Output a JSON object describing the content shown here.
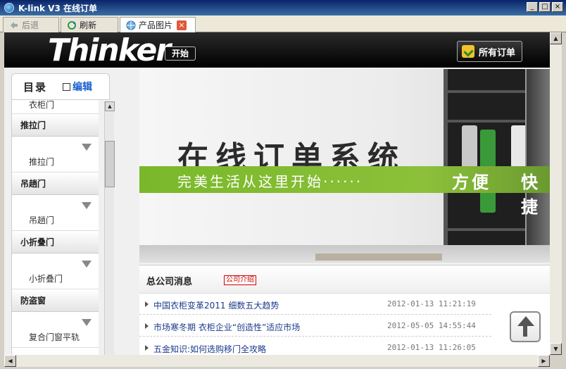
{
  "window": {
    "title": "K-link V3 在线订单"
  },
  "tabs": [
    {
      "label": "后退"
    },
    {
      "label": "刷新"
    },
    {
      "label": "产品图片"
    }
  ],
  "header": {
    "logo": "Thinker",
    "start_label": "开始",
    "orders_label": "所有订单"
  },
  "sidebar": {
    "title": "目录",
    "edit_label": "编辑",
    "first_item": "衣柜门",
    "categories": [
      {
        "name": "推拉门",
        "item": "推拉门"
      },
      {
        "name": "吊趟门",
        "item": "吊趟门"
      },
      {
        "name": "小折叠门",
        "item": "小折叠门"
      },
      {
        "name": "防盗窗",
        "item": "复合门窗平轨"
      }
    ]
  },
  "banner": {
    "headline": "在线订单系统",
    "slogan": "完美生活从这里开始······",
    "side_words": [
      "方便",
      "快捷"
    ]
  },
  "news": {
    "title": "总公司消息",
    "badge": "公司介绍",
    "items": [
      {
        "text": "中国衣柜变革2011 细数五大趋势",
        "date": "2012-01-13 11:21:19"
      },
      {
        "text": "市场寒冬期 衣柜企业“创造性”适应市场",
        "date": "2012-05-05 14:55:44"
      },
      {
        "text": "五金知识:如何选购移门全攻略",
        "date": "2012-01-13 11:26:05"
      }
    ]
  }
}
